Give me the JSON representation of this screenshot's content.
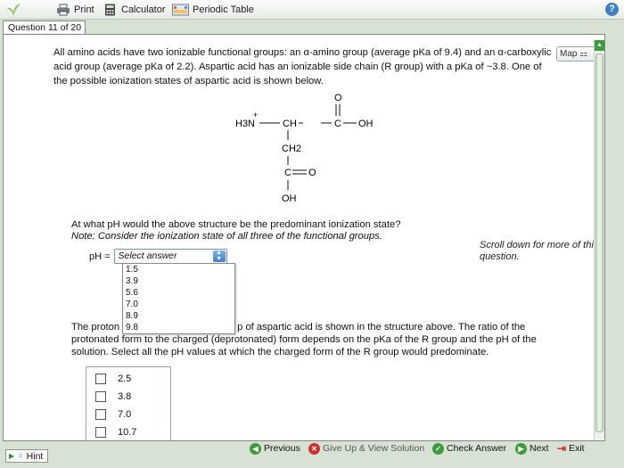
{
  "toolbar": {
    "print": "Print",
    "calculator": "Calculator",
    "periodic_table": "Periodic Table",
    "help": "?"
  },
  "question_tab": "Question 11 of 20",
  "passage": {
    "p1": "All amino acids have two ionizable functional groups: an α-amino group (average pKa of 9.4) and an α-carboxylic acid group (average pKa of 2.2). Aspartic acid has an ionizable side chain (R group) with a pKa of ~3.8. One of the possible ionization states of aspartic acid is shown below.",
    "map_label": "Map"
  },
  "structure": {
    "top_o": "O",
    "h3n": "H3N",
    "plus": "+",
    "ch": "CH",
    "c": "C",
    "oh_right": "OH",
    "ch2": "CH2",
    "c_side": "C",
    "o_side": "O",
    "oh_bottom": "OH"
  },
  "question1": {
    "text": "At what pH would the above structure be the predominant ionization state?",
    "note": "Note: Consider the ionization state of all three of the functional groups.",
    "ph_label": "pH =",
    "select_placeholder": "Select answer",
    "options": [
      "1.5",
      "3.9",
      "5.6",
      "7.0",
      "8.9",
      "9.8"
    ]
  },
  "scroll_hint": "Scroll down for more of this question.",
  "question2": {
    "text_left": "The proton",
    "text_rest": "p of aspartic acid is shown in the structure above. The ratio of the protonated form to the charged (deprotonated) form depends on the pKa of the R group and the pH of the solution. Select all the pH values at which the charged form of the R group would predominate.",
    "choices": [
      "2.5",
      "3.8",
      "7.0",
      "10.7"
    ]
  },
  "bottom": {
    "hint": "Hint",
    "previous": "Previous",
    "give_up": "Give Up & View Solution",
    "check": "Check Answer",
    "next": "Next",
    "exit": "Exit"
  },
  "colors": {
    "background": "#d8e2d4",
    "accent_green": "#3c9b3c",
    "accent_red": "#c83232"
  }
}
